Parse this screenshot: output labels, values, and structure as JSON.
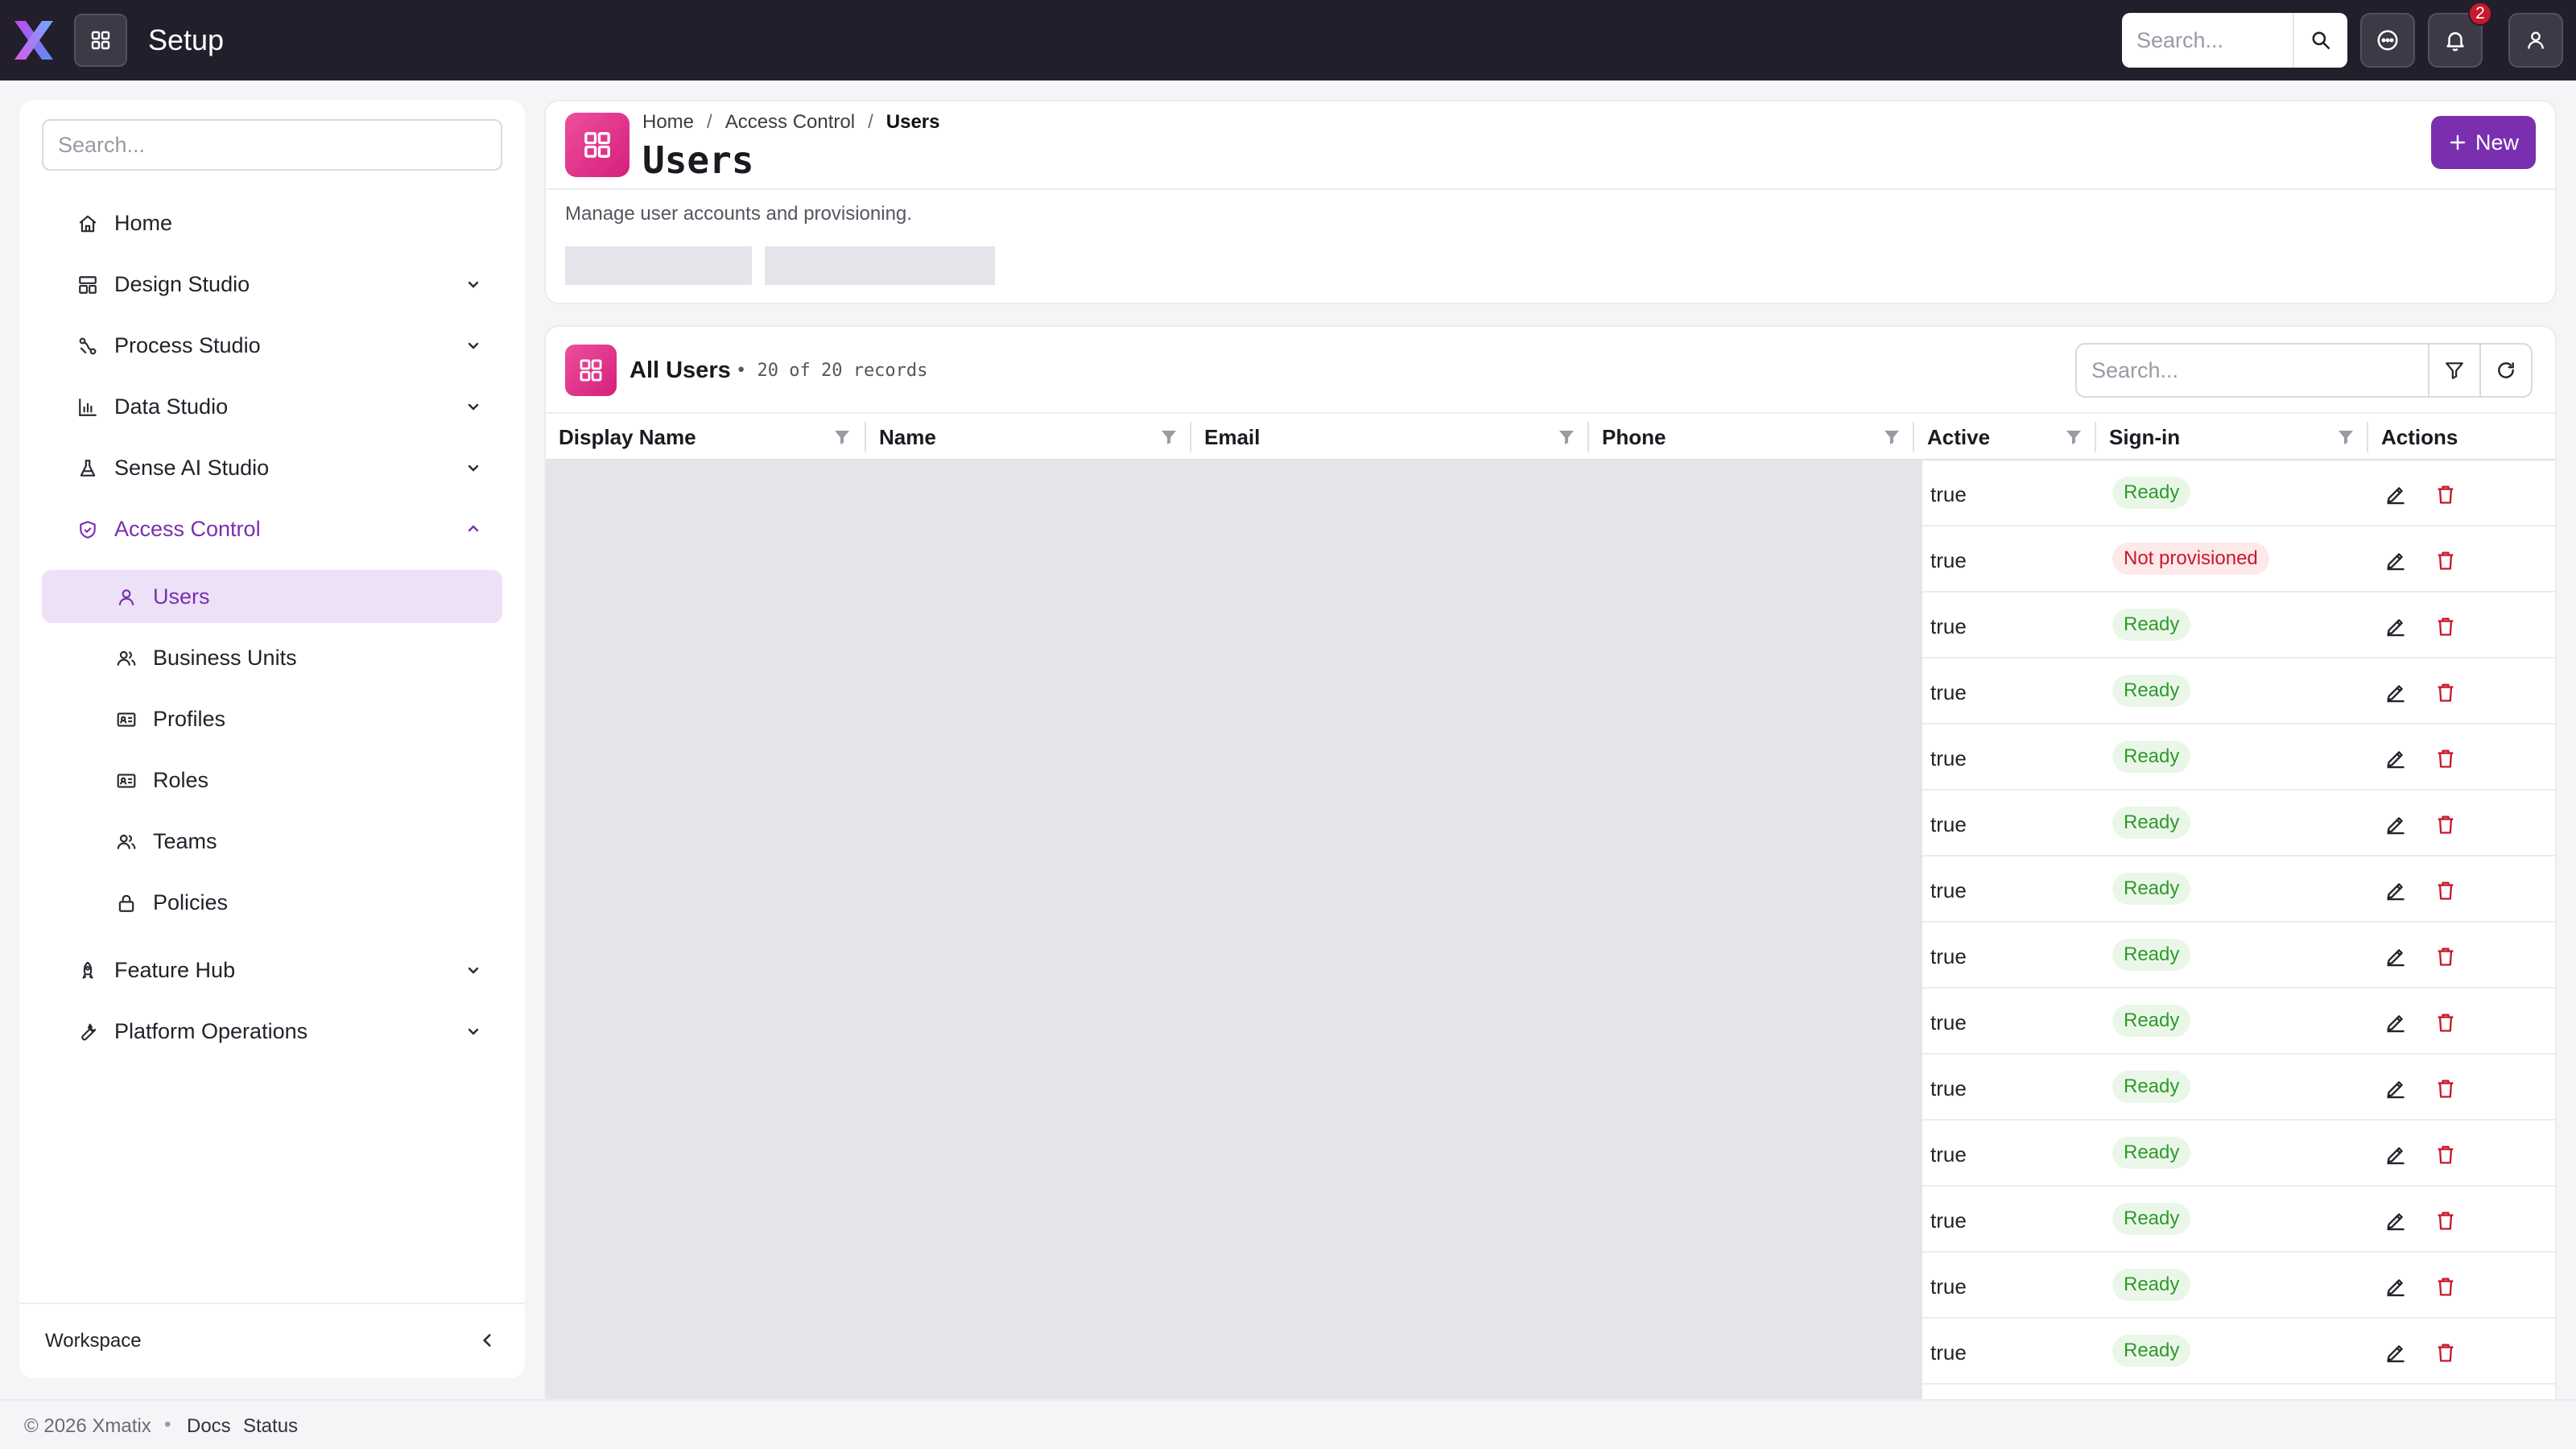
{
  "app": {
    "title": "Setup",
    "search_placeholder": "Search...",
    "notification_count": "2"
  },
  "sidebar": {
    "search_placeholder": "Search...",
    "items": [
      {
        "label": "Home",
        "icon": "home-icon"
      },
      {
        "label": "Design Studio",
        "icon": "design-studio-icon"
      },
      {
        "label": "Process Studio",
        "icon": "process-studio-icon"
      },
      {
        "label": "Data Studio",
        "icon": "chart-icon"
      },
      {
        "label": "Sense AI Studio",
        "icon": "flask-icon"
      },
      {
        "label": "Access Control",
        "icon": "shield-icon"
      },
      {
        "label": "Feature Hub",
        "icon": "rocket-icon"
      },
      {
        "label": "Platform Operations",
        "icon": "wrench-icon"
      }
    ],
    "sub_items": [
      {
        "label": "Users",
        "icon": "user-icon"
      },
      {
        "label": "Business Units",
        "icon": "users-icon"
      },
      {
        "label": "Profiles",
        "icon": "id-card-icon"
      },
      {
        "label": "Roles",
        "icon": "id-card-icon"
      },
      {
        "label": "Teams",
        "icon": "users-icon"
      },
      {
        "label": "Policies",
        "icon": "lock-icon"
      }
    ],
    "footer_label": "Workspace"
  },
  "header": {
    "breadcrumb": [
      "Home",
      "Access Control",
      "Users"
    ],
    "title": "Users",
    "description": "Manage user accounts and provisioning.",
    "new_button": "New"
  },
  "table": {
    "title": "All Users",
    "count": "• 20 of 20 records",
    "search_placeholder": "Search...",
    "columns": [
      "Display Name",
      "Name",
      "Email",
      "Phone",
      "Active",
      "Sign-in",
      "Actions"
    ],
    "rows": [
      {
        "active": "true",
        "signin": "Ready"
      },
      {
        "active": "true",
        "signin": "Not provisioned"
      },
      {
        "active": "true",
        "signin": "Ready"
      },
      {
        "active": "true",
        "signin": "Ready"
      },
      {
        "active": "true",
        "signin": "Ready"
      },
      {
        "active": "true",
        "signin": "Ready"
      },
      {
        "active": "true",
        "signin": "Ready"
      },
      {
        "active": "true",
        "signin": "Ready"
      },
      {
        "active": "true",
        "signin": "Ready"
      },
      {
        "active": "true",
        "signin": "Ready"
      },
      {
        "active": "true",
        "signin": "Ready"
      },
      {
        "active": "true",
        "signin": "Ready"
      },
      {
        "active": "true",
        "signin": "Ready"
      },
      {
        "active": "true",
        "signin": "Ready"
      }
    ]
  },
  "footer": {
    "copyright": "© 2026 Xmatix",
    "links": [
      "Docs",
      "Status"
    ]
  },
  "colors": {
    "accent": "#7a2fb0",
    "topbar": "#221e2b",
    "tile": "#e0358a",
    "ready": "#2f9a2a",
    "error": "#c8182c"
  }
}
